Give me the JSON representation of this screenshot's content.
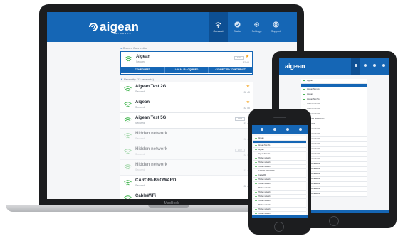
{
  "app": {
    "logo_text": "aigean",
    "logo_sub": "NETWORKS",
    "device_label": "MacBook"
  },
  "nav": [
    {
      "label": "Connect",
      "icon": "wifi-icon",
      "active": true
    },
    {
      "label": "Status",
      "icon": "check-circle-icon",
      "active": false
    },
    {
      "label": "Settings",
      "icon": "gear-icon",
      "active": false
    },
    {
      "label": "Support",
      "icon": "lifebuoy-icon",
      "active": false
    }
  ],
  "current_connection": {
    "heading": "Current Connection",
    "network": {
      "name": "Aigean",
      "security": "Secured",
      "favorite": true,
      "signal": "82 dB",
      "badge": "EDIT"
    },
    "actions": [
      "CONFIGURED",
      "LOCAL IP ACQUIRED",
      "CONNECTED TO INTERNET"
    ]
  },
  "proximity": {
    "heading": "Proximity",
    "heading_note": "(13 networks)",
    "networks": [
      {
        "name": "Aigean Test 2G",
        "security": "Secured",
        "favorite": true,
        "signal": "82 dB",
        "badge": "",
        "dim": false
      },
      {
        "name": "Aigean",
        "security": "Secured",
        "favorite": true,
        "signal": "82 dB",
        "badge": "",
        "dim": false
      },
      {
        "name": "Aigean Test 5G",
        "security": "Secured",
        "favorite": false,
        "signal": "82 dB",
        "badge": "EDIT",
        "dim": false
      },
      {
        "name": "Hidden network",
        "security": "Secured",
        "favorite": false,
        "signal": "82 dB",
        "badge": "",
        "dim": true
      },
      {
        "name": "Hidden network",
        "security": "Secured",
        "favorite": false,
        "signal": "82 dB",
        "badge": "EDIT",
        "dim": true
      },
      {
        "name": "Hidden network",
        "security": "Secured",
        "favorite": false,
        "signal": "82 dB",
        "badge": "",
        "dim": true
      },
      {
        "name": "CARONI-BROWARD",
        "security": "Secured",
        "favorite": false,
        "signal": "82 dB",
        "badge": "",
        "dim": false
      },
      {
        "name": "CableWiFi",
        "security": "Open",
        "favorite": false,
        "signal": "82 dB",
        "badge": "",
        "dim": false
      }
    ]
  },
  "tablet_rows": [
    "Aigean",
    "Aigean Test 2G",
    "Aigean",
    "Aigean Test 5G",
    "Hidden network",
    "Hidden network",
    "Hidden network",
    "CARONI-BROWARD",
    "CableWiFi",
    "Hidden network",
    "Hidden network",
    "Hidden network",
    "Hidden network",
    "Hidden network",
    "Hidden network",
    "Hidden network",
    "Hidden network",
    "Hidden network",
    "Hidden network",
    "Hidden network",
    "Hidden network",
    "Hidden network",
    "Hidden network"
  ],
  "phone_rows": [
    "Aigean",
    "Aigean Test 2G",
    "Aigean",
    "Aigean Test 5G",
    "Hidden network",
    "Hidden network",
    "Hidden network",
    "CARONI-BROWARD",
    "CableWiFi",
    "Hidden network",
    "Hidden network",
    "Hidden network",
    "Hidden network",
    "Hidden network",
    "Hidden network",
    "Hidden network",
    "Hidden network",
    "Hidden network",
    "Hidden network"
  ],
  "colors": {
    "brand_blue": "#1566b5",
    "active_nav": "#0d4f93",
    "wifi_green": "#3cb34a",
    "star": "#f5a623"
  }
}
